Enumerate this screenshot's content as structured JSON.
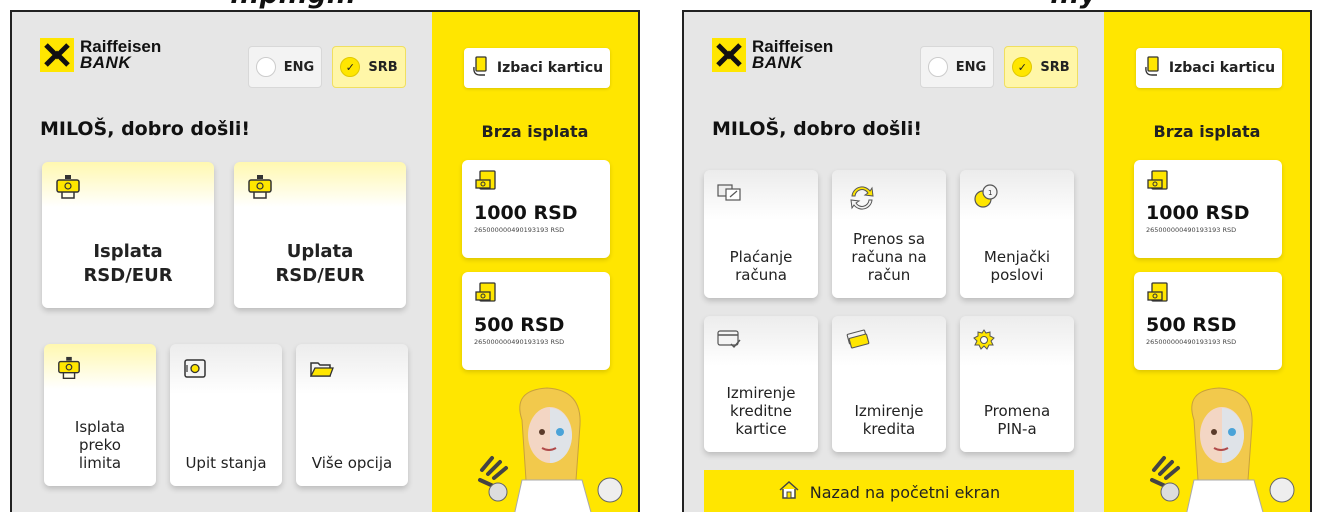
{
  "screens": [
    {
      "cut_title": "...p...g...",
      "brand": {
        "line1": "Raiffeisen",
        "line2": "BANK"
      },
      "languages": [
        {
          "label": "ENG",
          "selected": false
        },
        {
          "label": "SRB",
          "selected": true
        }
      ],
      "welcome": "MILOŠ, dobro došli!",
      "main_tiles": [
        {
          "label_line1": "Isplata",
          "label_line2": "RSD/EUR",
          "icon": "cash-dispense-icon"
        },
        {
          "label_line1": "Uplata",
          "label_line2": "RSD/EUR",
          "icon": "cash-deposit-icon"
        }
      ],
      "small_tiles": [
        {
          "label_line1": "Isplata",
          "label_line2": "preko",
          "label_line3": "limita",
          "icon": "cash-dispense-icon"
        },
        {
          "label_line1": "Upit stanja",
          "icon": "safe-icon"
        },
        {
          "label_line1": "Više opcija",
          "icon": "folder-icon"
        }
      ],
      "eject_card": "Izbaci karticu",
      "quick_title": "Brza isplata",
      "quick_withdrawals": [
        {
          "amount": "1000 RSD",
          "account": "265000000490193193 RSD"
        },
        {
          "amount": "500 RSD",
          "account": "265000000490193193 RSD"
        }
      ]
    },
    {
      "cut_title": "...y",
      "brand": {
        "line1": "Raiffeisen",
        "line2": "BANK"
      },
      "languages": [
        {
          "label": "ENG",
          "selected": false
        },
        {
          "label": "SRB",
          "selected": true
        }
      ],
      "welcome": "MILOŠ, dobro došli!",
      "option_tiles": [
        {
          "line1": "Plaćanje",
          "line2": "računa",
          "line3": "",
          "icon": "bill-payment-icon"
        },
        {
          "line1": "Prenos sa",
          "line2": "računa na",
          "line3": "račun",
          "icon": "transfer-arrows-icon"
        },
        {
          "line1": "Menjački",
          "line2": "poslovi",
          "line3": "",
          "icon": "currency-exchange-icon"
        },
        {
          "line1": "Izmirenje",
          "line2": "kreditne",
          "line3": "kartice",
          "icon": "credit-card-icon"
        },
        {
          "line1": "Izmirenje",
          "line2": "kredita",
          "line3": "",
          "icon": "money-stack-icon"
        },
        {
          "line1": "Promena",
          "line2": "PIN-a",
          "line3": "",
          "icon": "gear-icon"
        }
      ],
      "home_button": "Nazad na početni ekran",
      "eject_card": "Izbaci karticu",
      "quick_title": "Brza isplata",
      "quick_withdrawals": [
        {
          "amount": "1000 RSD",
          "account": "265000000490193193 RSD"
        },
        {
          "amount": "500 RSD",
          "account": "265000000490193193 RSD"
        }
      ]
    }
  ],
  "colors": {
    "brand_yellow": "#ffe600",
    "panel_grey": "#e6e6e6"
  }
}
